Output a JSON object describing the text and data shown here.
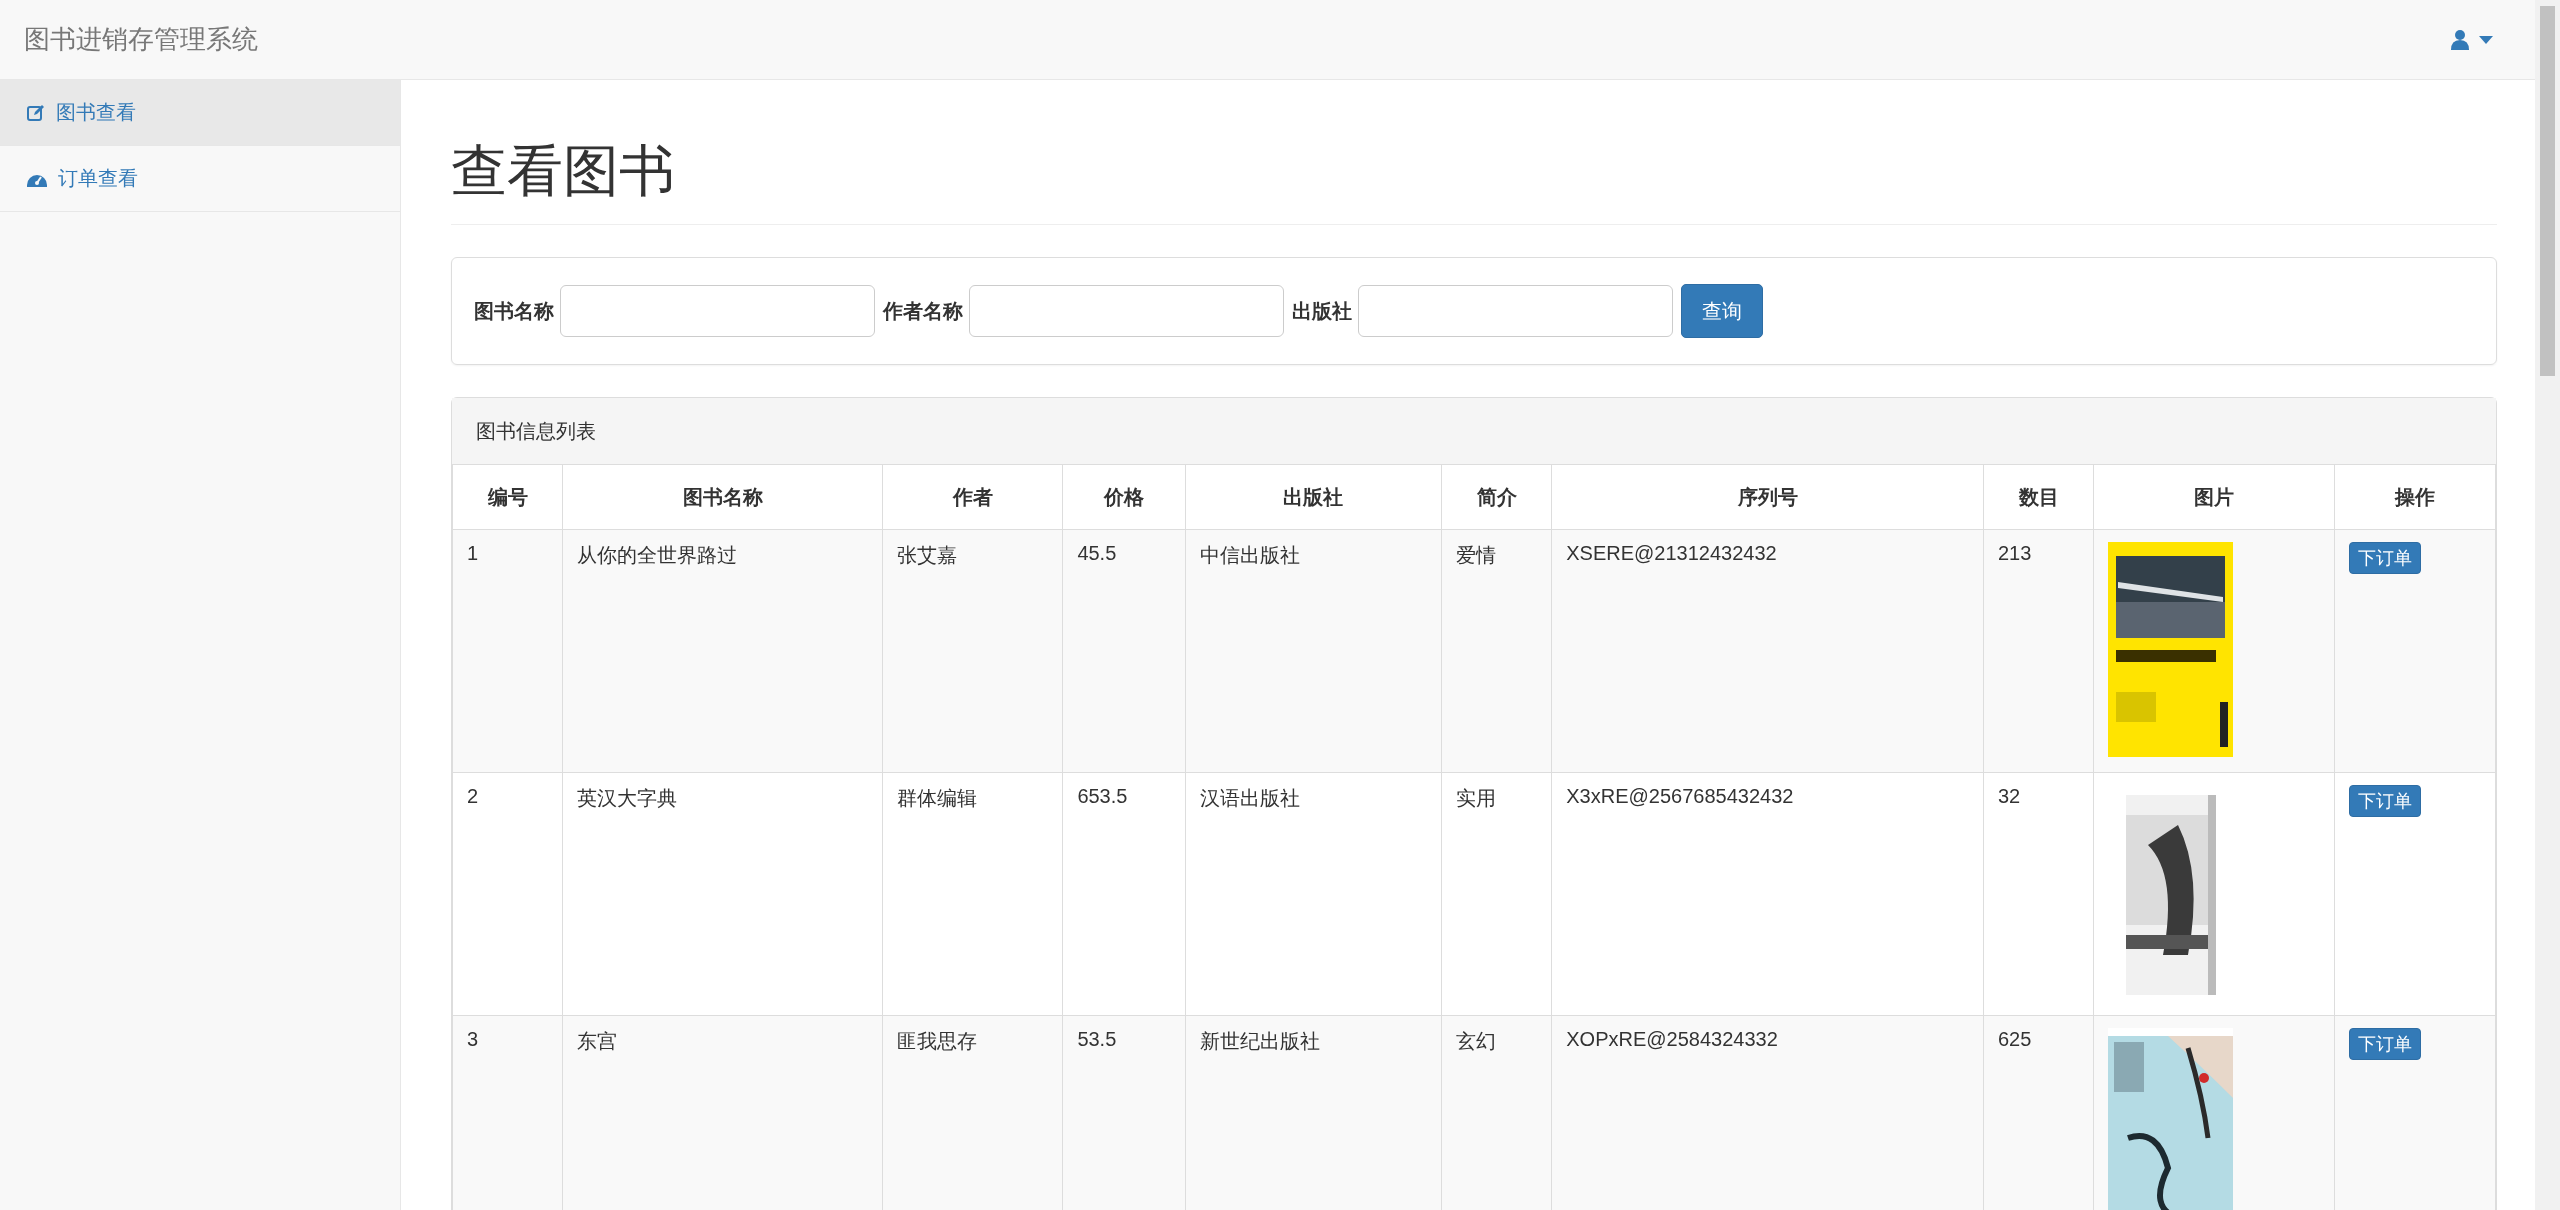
{
  "navbar": {
    "brand": "图书进销存管理系统"
  },
  "sidebar": {
    "items": [
      {
        "label": "图书查看",
        "selected": true
      },
      {
        "label": "订单查看",
        "selected": false
      }
    ]
  },
  "page_title": "查看图书",
  "search": {
    "fields": [
      {
        "label": "图书名称"
      },
      {
        "label": "作者名称"
      },
      {
        "label": "出版社"
      }
    ],
    "button": "查询"
  },
  "table_panel": {
    "heading": "图书信息列表",
    "columns": [
      "编号",
      "图书名称",
      "作者",
      "价格",
      "出版社",
      "简介",
      "序列号",
      "数目",
      "图片",
      "操作"
    ],
    "rows": [
      {
        "cells": [
          "1",
          "从你的全世界路过",
          "张艾嘉",
          "45.5",
          "中信出版社",
          "爱情",
          "XSERE@21312432432",
          "213"
        ],
        "action": "下订单"
      },
      {
        "cells": [
          "2",
          "英汉大字典",
          "群体编辑",
          "653.5",
          "汉语出版社",
          "实用",
          "X3xRE@2567685432432",
          "32"
        ],
        "action": "下订单"
      },
      {
        "cells": [
          "3",
          "东宫",
          "匪我思存",
          "53.5",
          "新世纪出版社",
          "玄幻",
          "XOPxRE@2584324332",
          "625"
        ],
        "action": "下订单"
      }
    ]
  }
}
